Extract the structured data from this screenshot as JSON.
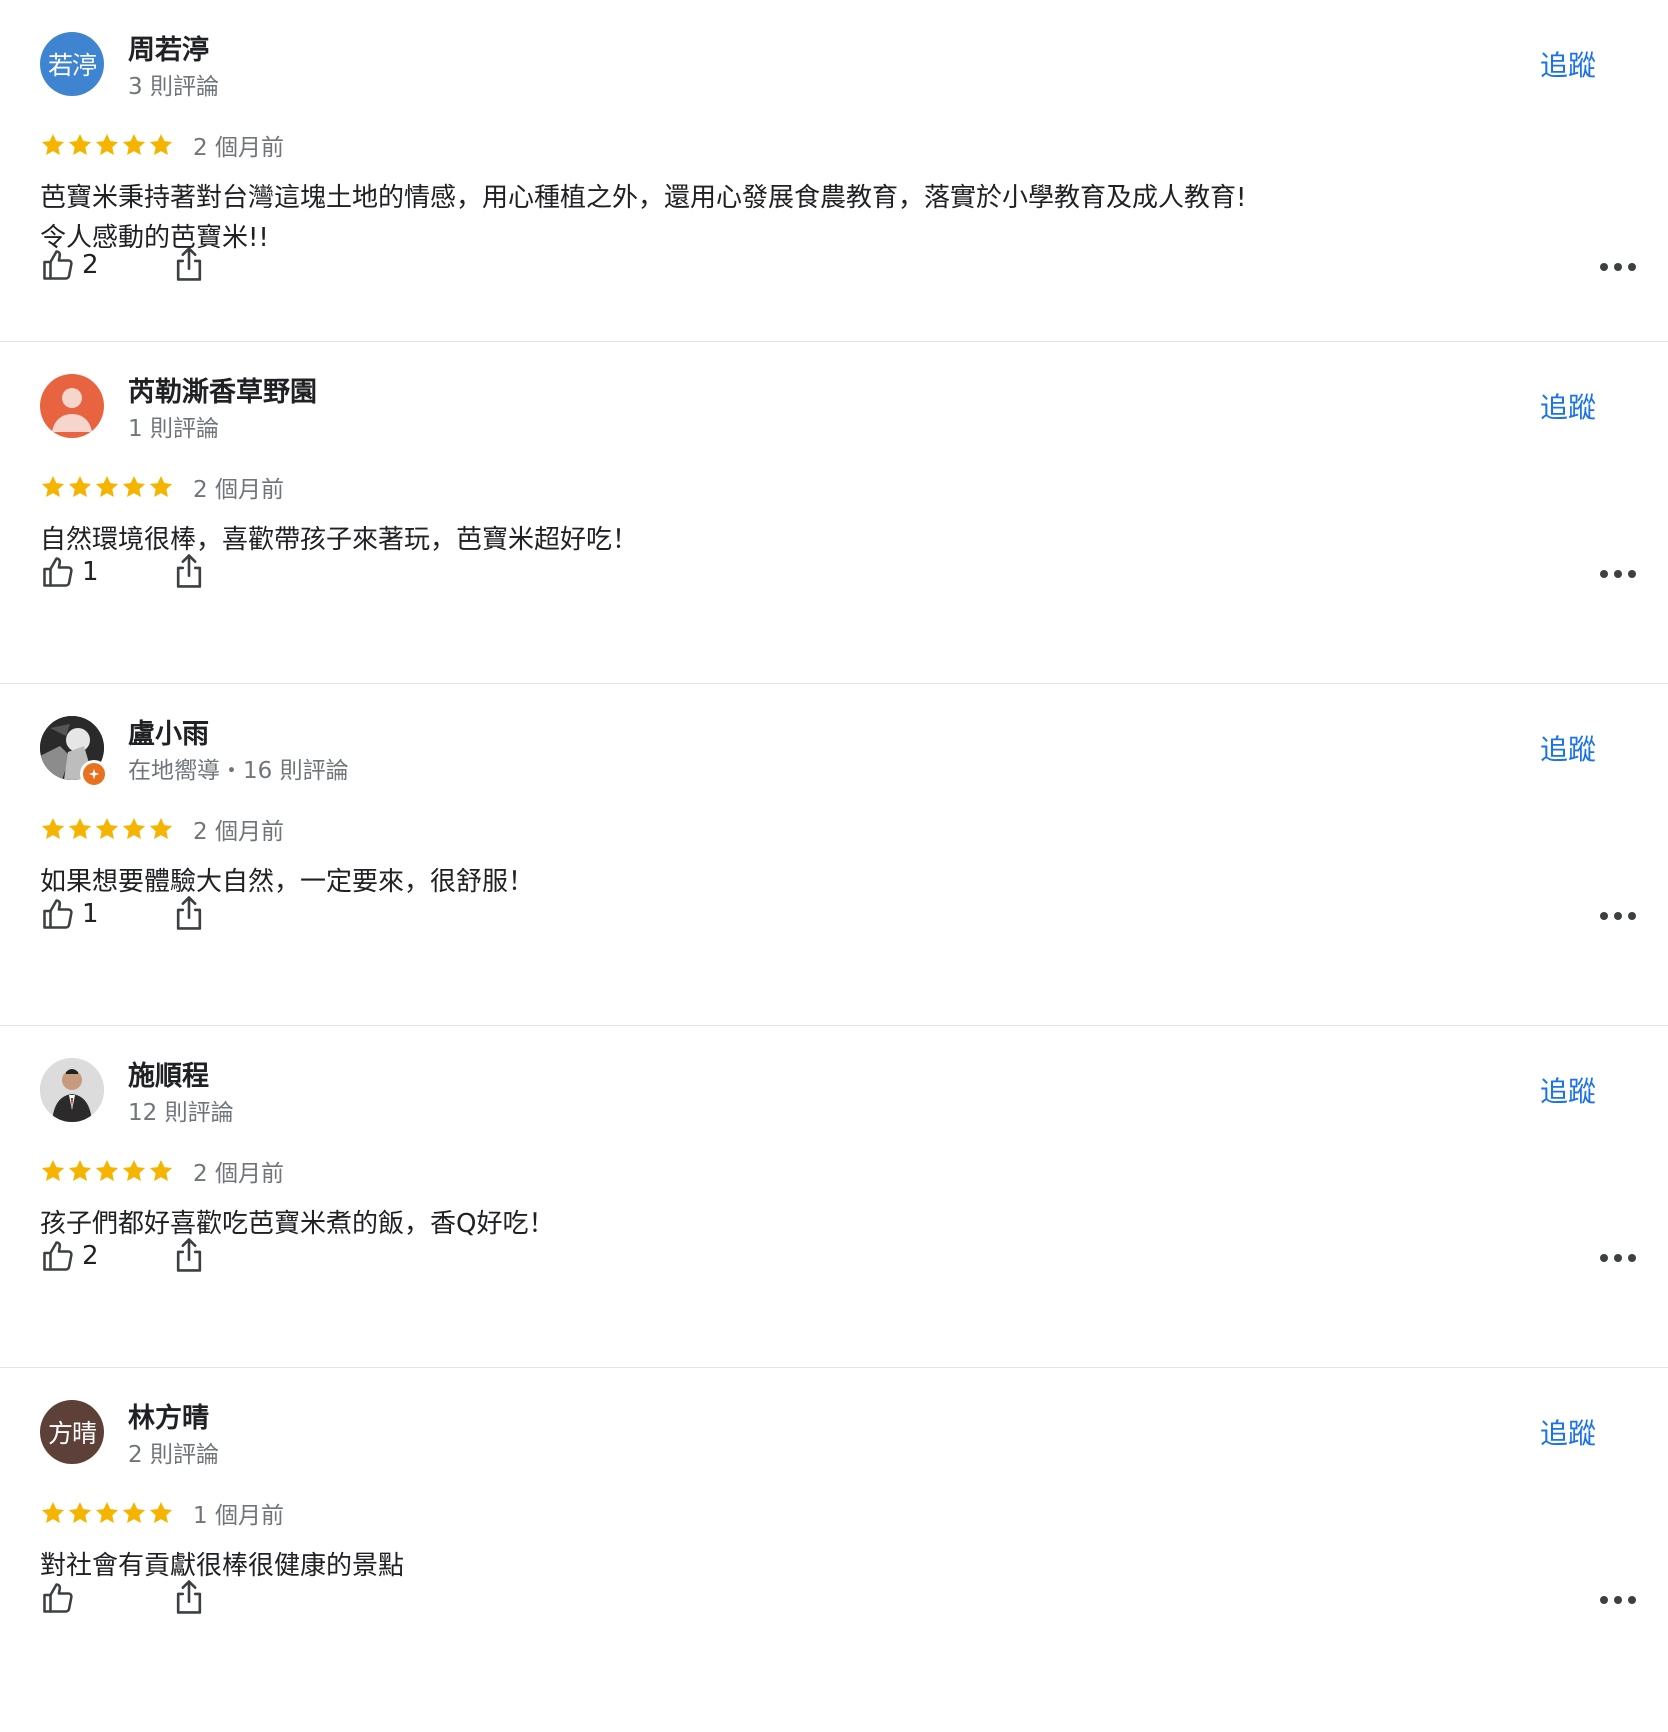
{
  "colors": {
    "accent": "#1a73e8",
    "star": "#f4b400",
    "text_primary": "#202124",
    "text_secondary": "#70757a"
  },
  "reviews": [
    {
      "avatar": {
        "type": "initials",
        "text": "若渟",
        "bg": "#3f84d0"
      },
      "name": "周若渟",
      "meta": "3 則評論",
      "follow_label": "追蹤",
      "rating": 5,
      "time": "2 個月前",
      "text": "芭寶米秉持著對台灣這塊土地的情感，用心種植之外，還用心發展食農教育，落實於小學教育及成人教育!\n令人感動的芭寶米!!",
      "likes": "2",
      "icons": {
        "like": "thumbs-up-icon",
        "share": "share-icon",
        "more": "more-horiz-icon"
      }
    },
    {
      "avatar": {
        "type": "person-silhouette",
        "bg": "#e86440"
      },
      "name": "芮勒澌香草野園",
      "meta": "1 則評論",
      "follow_label": "追蹤",
      "rating": 5,
      "time": "2 個月前",
      "text": "自然環境很棒，喜歡帶孩子來著玩，芭寶米超好吃！",
      "likes": "1",
      "icons": {
        "like": "thumbs-up-icon",
        "share": "share-icon",
        "more": "more-horiz-icon"
      }
    },
    {
      "avatar": {
        "type": "photo-dark",
        "bg": "#2a2a2a",
        "badge": "local-guide-badge-icon"
      },
      "name": "盧小雨",
      "meta": "在地嚮導・16 則評論",
      "follow_label": "追蹤",
      "rating": 5,
      "time": "2 個月前",
      "text": "如果想要體驗大自然，一定要來，很舒服！",
      "likes": "1",
      "icons": {
        "like": "thumbs-up-icon",
        "share": "share-icon",
        "more": "more-horiz-icon"
      }
    },
    {
      "avatar": {
        "type": "photo-portrait",
        "bg": "#d9d9d9"
      },
      "name": "施順程",
      "meta": "12 則評論",
      "follow_label": "追蹤",
      "rating": 5,
      "time": "2 個月前",
      "text": "孩子們都好喜歡吃芭寶米煮的飯，香Q好吃！",
      "likes": "2",
      "icons": {
        "like": "thumbs-up-icon",
        "share": "share-icon",
        "more": "more-horiz-icon"
      }
    },
    {
      "avatar": {
        "type": "initials",
        "text": "方晴",
        "bg": "#5d4037"
      },
      "name": "林方晴",
      "meta": "2 則評論",
      "follow_label": "追蹤",
      "rating": 5,
      "time": "1 個月前",
      "text": "對社會有貢獻很棒很健康的景點",
      "likes": "",
      "icons": {
        "like": "thumbs-up-icon",
        "share": "share-icon",
        "more": "more-horiz-icon"
      }
    }
  ]
}
